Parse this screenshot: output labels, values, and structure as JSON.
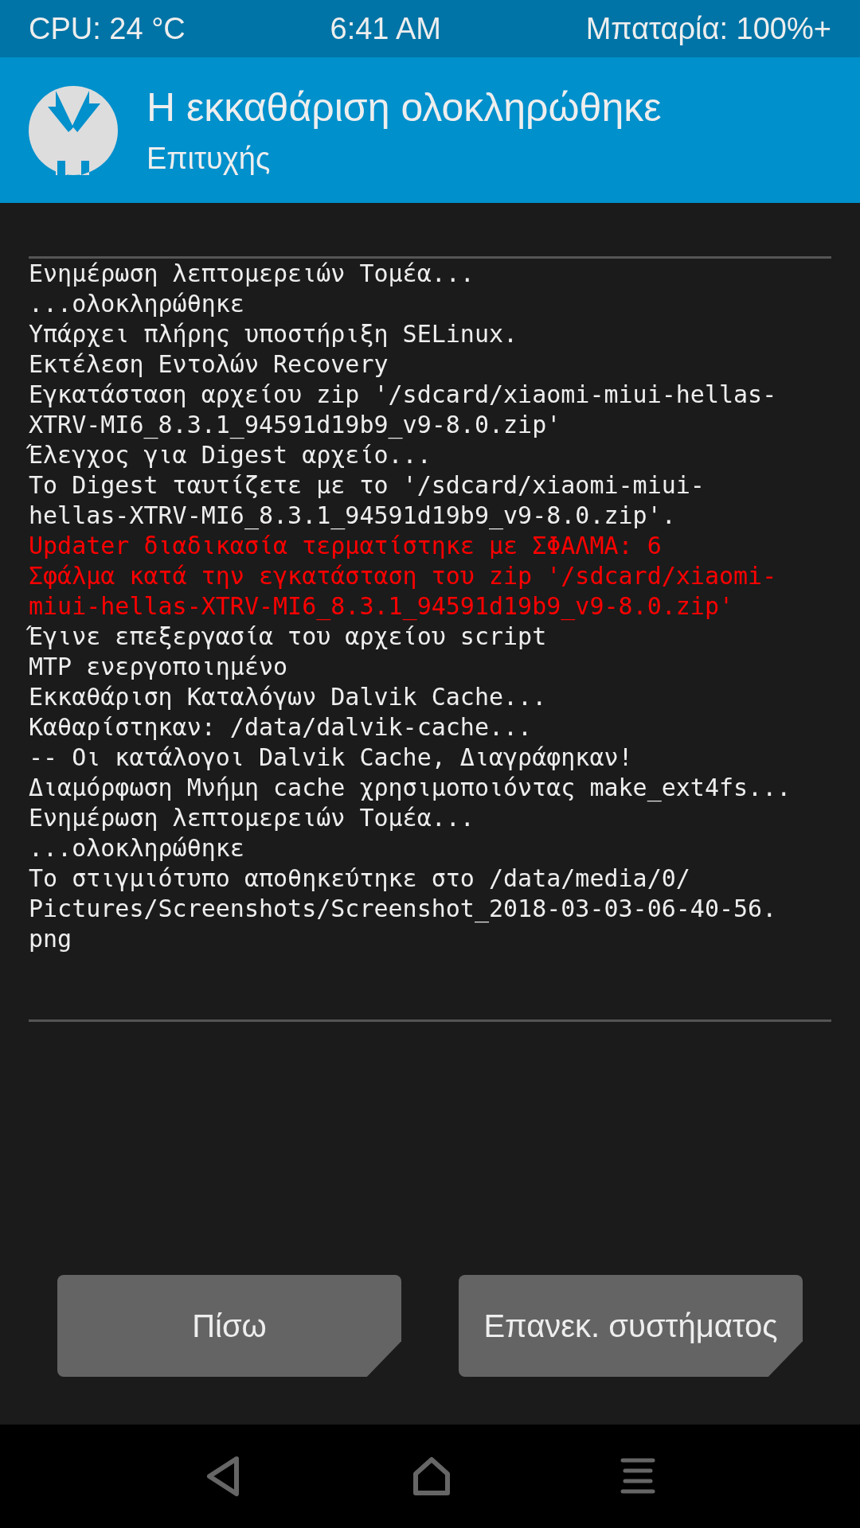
{
  "status_bar": {
    "cpu": "CPU: 24 °C",
    "time": "6:41 AM",
    "battery": "Μπαταρία: 100%+"
  },
  "header": {
    "title": "Η εκκαθάριση ολοκληρώθηκε",
    "subtitle": "Επιτυχής"
  },
  "log": [
    {
      "kind": "info",
      "text": "Ενημέρωση λεπτομερειών Τομέα..."
    },
    {
      "kind": "info",
      "text": "...ολοκληρώθηκε"
    },
    {
      "kind": "info",
      "text": "Υπάρχει πλήρης υποστήριξη SELinux."
    },
    {
      "kind": "info",
      "text": "Εκτέλεση Εντολών Recovery"
    },
    {
      "kind": "info",
      "text": "Εγκατάσταση αρχείου zip '/sdcard/xiaomi-miui-hellas-"
    },
    {
      "kind": "info",
      "text": "XTRV-MI6_8.3.1_94591d19b9_v9-8.0.zip'"
    },
    {
      "kind": "info",
      "text": "Έλεγχος για Digest αρχείο..."
    },
    {
      "kind": "info",
      "text": "Το Digest ταυτίζετε με το '/sdcard/xiaomi-miui-"
    },
    {
      "kind": "info",
      "text": "hellas-XTRV-MI6_8.3.1_94591d19b9_v9-8.0.zip'."
    },
    {
      "kind": "error",
      "text": "Updater διαδικασία τερματίστηκε με ΣΦΑΛΜΑ: 6"
    },
    {
      "kind": "error",
      "text": "Σφάλμα κατά την εγκατάσταση του zip '/sdcard/xiaomi-"
    },
    {
      "kind": "error",
      "text": "miui-hellas-XTRV-MI6_8.3.1_94591d19b9_v9-8.0.zip'"
    },
    {
      "kind": "info",
      "text": "Έγινε επεξεργασία του αρχείου script"
    },
    {
      "kind": "info",
      "text": "MTP ενεργοποιημένο"
    },
    {
      "kind": "info",
      "text": "Εκκαθάριση Καταλόγων Dalvik Cache..."
    },
    {
      "kind": "info",
      "text": "Καθαρίστηκαν: /data/dalvik-cache..."
    },
    {
      "kind": "info",
      "text": "-- Οι κατάλογοι Dalvik Cache, Διαγράφηκαν!"
    },
    {
      "kind": "info",
      "text": "Διαμόρφωση Μνήμη cache χρησιμοποιόντας make_ext4fs..."
    },
    {
      "kind": "info",
      "text": "Ενημέρωση λεπτομερειών Τομέα..."
    },
    {
      "kind": "info",
      "text": "...ολοκληρώθηκε"
    },
    {
      "kind": "info",
      "text": "Το στιγμιότυπο αποθηκεύτηκε στο /data/media/0/"
    },
    {
      "kind": "info",
      "text": "Pictures/Screenshots/Screenshot_2018-03-03-06-40-56."
    },
    {
      "kind": "info",
      "text": "png"
    }
  ],
  "buttons": [
    "Πίσω",
    "Επανεκ. συστήματος"
  ]
}
